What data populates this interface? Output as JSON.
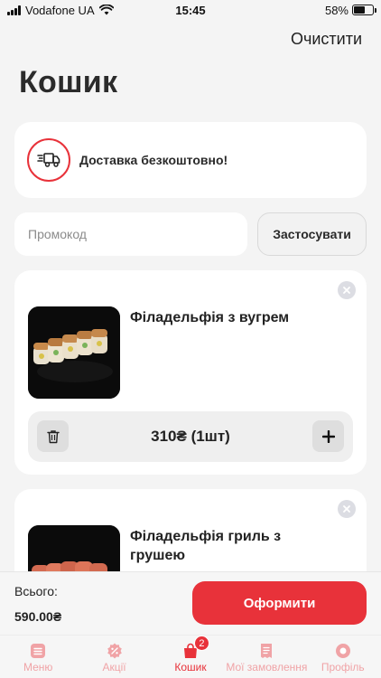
{
  "status_bar": {
    "carrier": "Vodafone UA",
    "time": "15:45",
    "battery": "58%",
    "battery_level": 0.58
  },
  "header": {
    "clear_label": "Очистити",
    "title": "Кошик"
  },
  "delivery": {
    "icon": "delivery-truck-icon",
    "text": "Доставка безкоштовно!"
  },
  "promo": {
    "placeholder": "Промокод",
    "value": "",
    "apply_label": "Застосувати"
  },
  "cart_items": [
    {
      "name": "Філадельфія з вугрем",
      "price_qty": "310₴ (1шт)"
    },
    {
      "name": "Філадельфія гриль з грушею"
    }
  ],
  "checkout": {
    "total_label": "Всього:",
    "total_value": "590.00₴",
    "button_label": "Оформити"
  },
  "tabs": [
    {
      "label": "Меню",
      "icon": "menu-icon",
      "active": false
    },
    {
      "label": "Акції",
      "icon": "promo-badge-icon",
      "active": false
    },
    {
      "label": "Кошик",
      "icon": "cart-icon",
      "active": true,
      "badge": "2"
    },
    {
      "label": "Мої замовлення",
      "icon": "orders-receipt-icon",
      "active": false
    },
    {
      "label": "Профіль",
      "icon": "profile-icon",
      "active": false
    }
  ],
  "colors": {
    "accent": "#e8323a",
    "background": "#f4f4f4",
    "card": "#ffffff"
  }
}
